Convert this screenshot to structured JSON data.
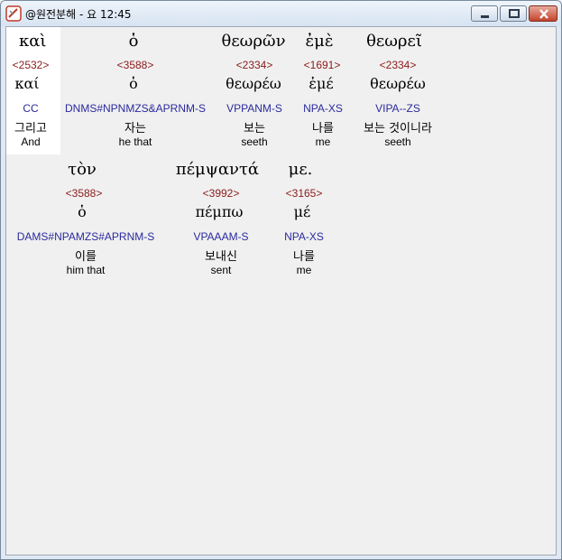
{
  "window": {
    "title": "@원전분해 - 요 12:45"
  },
  "rows": [
    {
      "words": [
        {
          "greek": "καὶ",
          "strong": "<2532>",
          "lemma": "καί",
          "parse": "CC",
          "korean": "그리고",
          "english": "And"
        },
        {
          "greek": "ὁ",
          "strong": "<3588>",
          "lemma": "ὁ",
          "parse": "DNMS#NPNMZS&APRNM-S",
          "korean": "자는",
          "english": "he that"
        },
        {
          "greek": "θεωρῶν",
          "strong": "<2334>",
          "lemma": "θεωρέω",
          "parse": "VPPANM-S",
          "korean": "보는",
          "english": "seeth"
        },
        {
          "greek": "ἐμὲ",
          "strong": "<1691>",
          "lemma": "ἐμέ",
          "parse": "NPA-XS",
          "korean": "나를",
          "english": "me"
        },
        {
          "greek": "θεωρεῖ",
          "strong": "<2334>",
          "lemma": "θεωρέω",
          "parse": "VIPA--ZS",
          "korean": "보는 것이니라",
          "english": "seeth"
        }
      ]
    },
    {
      "words": [
        {
          "greek": "τὸν",
          "strong": "<3588>",
          "lemma": "ὁ",
          "parse": "DAMS#NPAMZS#APRNM-S",
          "korean": "이를",
          "english": "him that"
        },
        {
          "greek": "πέμψαντά",
          "strong": "<3992>",
          "lemma": "πέμπω",
          "parse": "VPAAAM-S",
          "korean": "보내신",
          "english": "sent"
        },
        {
          "greek": "με.",
          "strong": "<3165>",
          "lemma": "μέ",
          "parse": "NPA-XS",
          "korean": "나를",
          "english": "me"
        }
      ]
    }
  ]
}
